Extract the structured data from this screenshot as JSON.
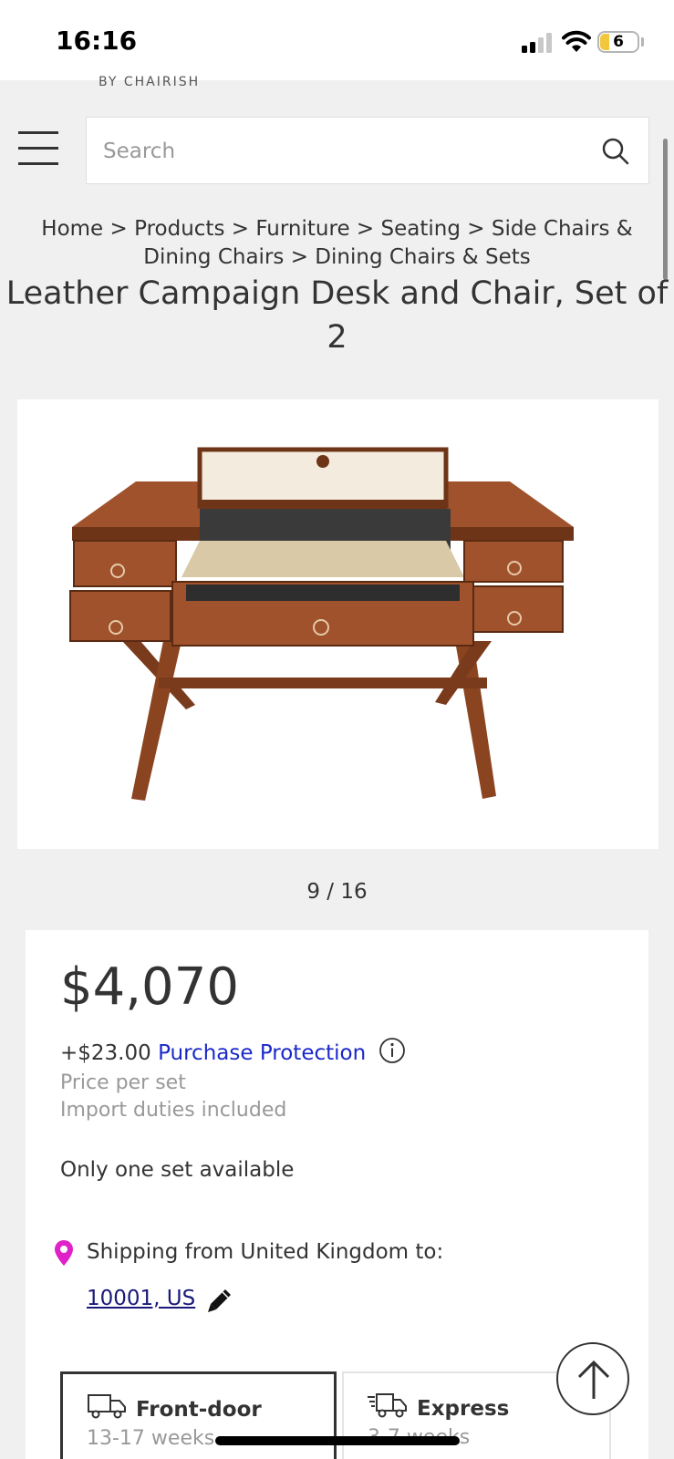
{
  "status_bar": {
    "time": "16:16",
    "battery": "6"
  },
  "header": {
    "brand_sub": "BY CHAIRISH",
    "search_placeholder": "Search"
  },
  "breadcrumb": [
    "Home",
    "Products",
    "Furniture",
    "Seating",
    "Side Chairs & Dining Chairs",
    "Dining Chairs & Sets"
  ],
  "product": {
    "title": "Leather Campaign Desk and Chair, Set of 2",
    "gallery_counter": "9 / 16",
    "price": "$4,070",
    "protection_amount": "+$23.00",
    "protection_label": "Purchase Protection",
    "price_per": "Price per set",
    "duties": "Import duties included",
    "availability": "Only one set available"
  },
  "shipping": {
    "from_label": "Shipping from United Kingdom to:",
    "destination": "10001, US",
    "options": [
      {
        "name": "Front-door",
        "time": "13-17 weeks"
      },
      {
        "name": "Express",
        "time": "3-7 weeks"
      }
    ]
  },
  "colors": {
    "accent_link": "#1a28c8",
    "pin": "#e020c8",
    "text": "#333333"
  }
}
